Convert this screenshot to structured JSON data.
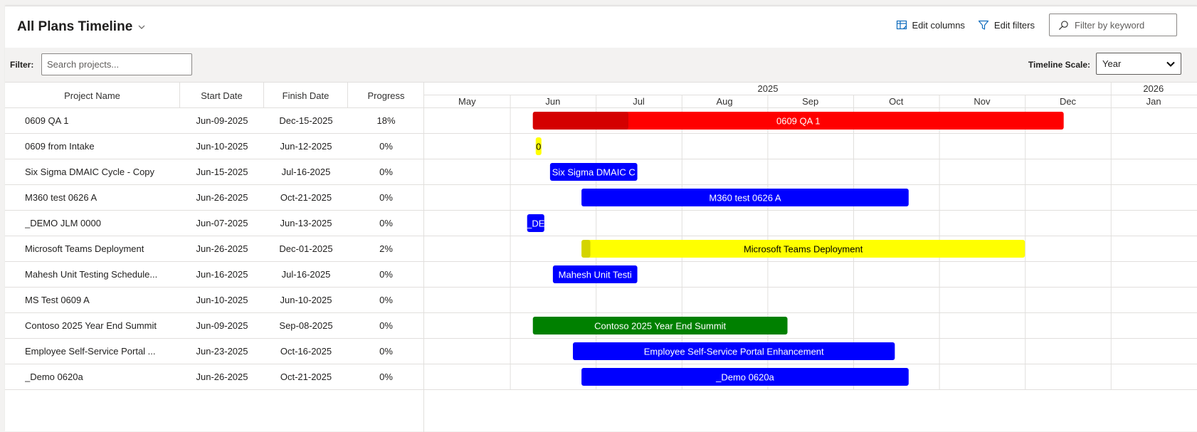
{
  "header": {
    "title": "All Plans Timeline",
    "edit_columns": "Edit columns",
    "edit_filters": "Edit filters",
    "keyword_placeholder": "Filter by keyword"
  },
  "toolbar": {
    "filter_label": "Filter:",
    "search_placeholder": "Search projects...",
    "scale_label": "Timeline Scale:",
    "scale_value": "Year"
  },
  "columns": {
    "name": "Project Name",
    "start": "Start Date",
    "finish": "Finish Date",
    "progress": "Progress"
  },
  "timeline_header": {
    "years": [
      "2025",
      "2026"
    ],
    "months": [
      "May",
      "Jun",
      "Jul",
      "Aug",
      "Sep",
      "Oct",
      "Nov",
      "Dec",
      "Jan"
    ]
  },
  "projects": [
    {
      "name": "0609 QA 1",
      "start": "Jun-09-2025",
      "finish": "Dec-15-2025",
      "progress": "18%",
      "progress_value": 0.18,
      "bar_label": "0609 QA 1",
      "color": "#ff0000",
      "progress_color": "#d40000",
      "text_color": "#ffffff"
    },
    {
      "name": "0609 from Intake",
      "start": "Jun-10-2025",
      "finish": "Jun-12-2025",
      "progress": "0%",
      "progress_value": 0,
      "bar_label": "0",
      "color": "#ffff00",
      "progress_color": "#d4d400",
      "text_color": "#000000"
    },
    {
      "name": "Six Sigma DMAIC Cycle - Copy",
      "start": "Jun-15-2025",
      "finish": "Jul-16-2025",
      "progress": "0%",
      "progress_value": 0,
      "bar_label": "Six Sigma DMAIC C",
      "color": "#0000ff",
      "progress_color": "#0000cc",
      "text_color": "#ffffff"
    },
    {
      "name": "M360 test 0626 A",
      "start": "Jun-26-2025",
      "finish": "Oct-21-2025",
      "progress": "0%",
      "progress_value": 0,
      "bar_label": "M360 test 0626 A",
      "color": "#0000ff",
      "progress_color": "#0000cc",
      "text_color": "#ffffff"
    },
    {
      "name": "_DEMO JLM 0000",
      "start": "Jun-07-2025",
      "finish": "Jun-13-2025",
      "progress": "0%",
      "progress_value": 0,
      "bar_label": "_DE",
      "color": "#0000ff",
      "progress_color": "#0000cc",
      "text_color": "#ffffff"
    },
    {
      "name": "Microsoft Teams Deployment",
      "start": "Jun-26-2025",
      "finish": "Dec-01-2025",
      "progress": "2%",
      "progress_value": 0.02,
      "bar_label": "Microsoft Teams Deployment",
      "color": "#ffff00",
      "progress_color": "#d4d400",
      "text_color": "#000000"
    },
    {
      "name": "Mahesh Unit Testing Schedule...",
      "start": "Jun-16-2025",
      "finish": "Jul-16-2025",
      "progress": "0%",
      "progress_value": 0,
      "bar_label": "Mahesh Unit Testi",
      "color": "#0000ff",
      "progress_color": "#0000cc",
      "text_color": "#ffffff"
    },
    {
      "name": "MS Test 0609 A",
      "start": "Jun-10-2025",
      "finish": "Jun-10-2025",
      "progress": "0%",
      "progress_value": 0,
      "bar_label": "",
      "color": "#0000ff",
      "progress_color": "#0000cc",
      "text_color": "#ffffff"
    },
    {
      "name": "Contoso 2025 Year End Summit",
      "start": "Jun-09-2025",
      "finish": "Sep-08-2025",
      "progress": "0%",
      "progress_value": 0,
      "bar_label": "Contoso 2025 Year End Summit",
      "color": "#008000",
      "progress_color": "#006400",
      "text_color": "#ffffff"
    },
    {
      "name": "Employee Self-Service Portal ...",
      "start": "Jun-23-2025",
      "finish": "Oct-16-2025",
      "progress": "0%",
      "progress_value": 0,
      "bar_label": "Employee Self-Service Portal Enhancement",
      "color": "#0000ff",
      "progress_color": "#0000cc",
      "text_color": "#ffffff"
    },
    {
      "name": "_Demo 0620a",
      "start": "Jun-26-2025",
      "finish": "Oct-21-2025",
      "progress": "0%",
      "progress_value": 0,
      "bar_label": "_Demo 0620a",
      "color": "#0000ff",
      "progress_color": "#0000cc",
      "text_color": "#ffffff"
    }
  ],
  "colors": {
    "grid_line": "#e1dfdd",
    "header_bg": "#f3f2f1"
  }
}
